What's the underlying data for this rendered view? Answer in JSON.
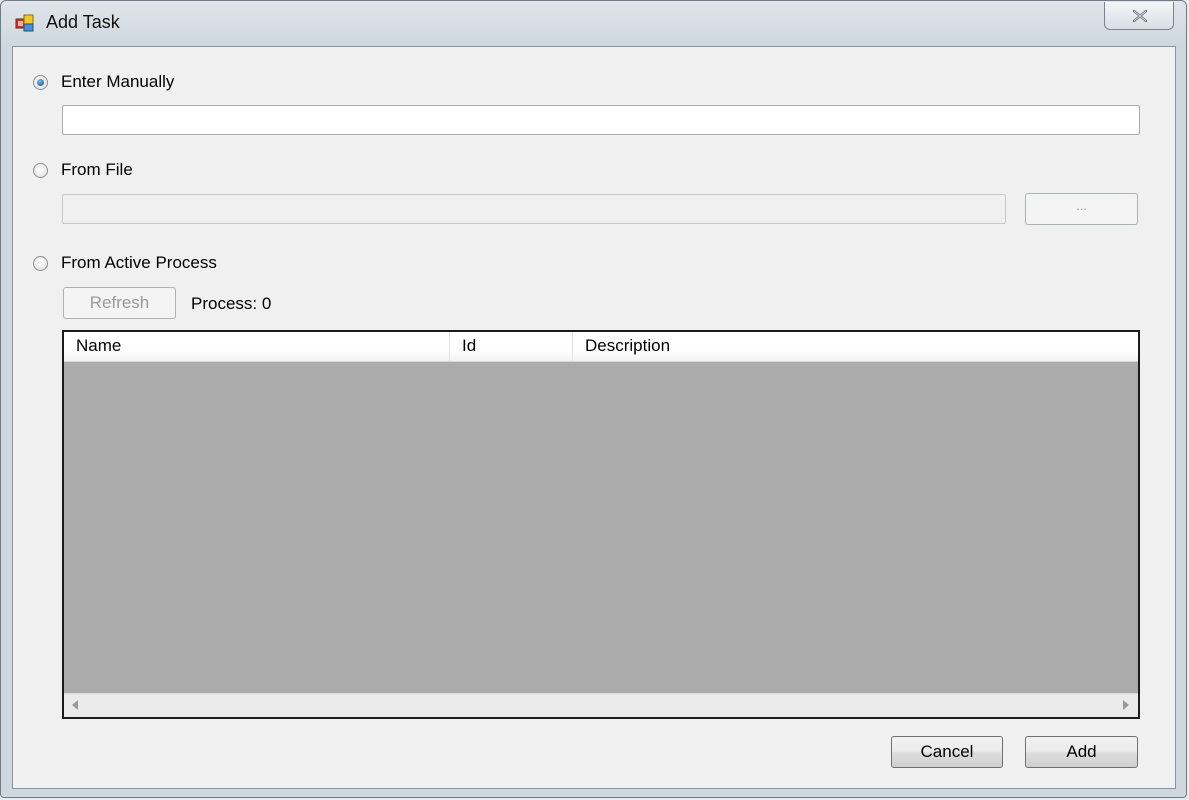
{
  "window": {
    "title": "Add Task",
    "icon": "app-window-icon",
    "close_icon": "close-x-icon"
  },
  "options": {
    "manual": {
      "label": "Enter Manually",
      "selected": true,
      "input_value": ""
    },
    "from_file": {
      "label": "From File",
      "selected": false,
      "input_value": "",
      "browse_label": "..."
    },
    "active_process": {
      "label": "From Active Process",
      "selected": false,
      "refresh_label": "Refresh",
      "process_count": "Process: 0"
    }
  },
  "process_list": {
    "columns": [
      "Name",
      "Id",
      "Description"
    ],
    "rows": []
  },
  "footer": {
    "cancel_label": "Cancel",
    "add_label": "Add"
  }
}
